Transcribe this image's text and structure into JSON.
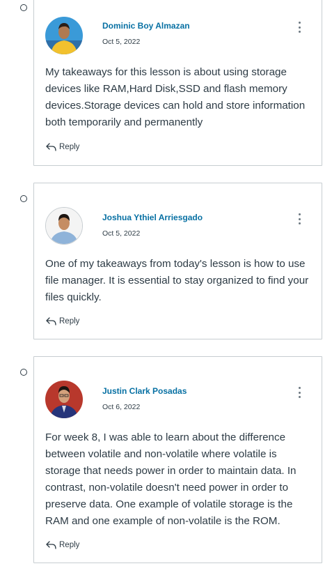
{
  "posts": [
    {
      "author": "Dominic Boy Almazan",
      "date": "Oct 5, 2022",
      "body": "My takeaways for this lesson is about using storage devices like RAM,Hard Disk,SSD and flash memory devices.Storage devices can hold and store information both temporarily and permanently",
      "reply_label": "Reply"
    },
    {
      "author": "Joshua Ythiel Arriesgado",
      "date": "Oct 5, 2022",
      "body": "One of my takeaways from today's lesson is how to use file manager. It is essential to stay organized to find your files quickly.",
      "reply_label": "Reply"
    },
    {
      "author": "Justin Clark Posadas",
      "date": "Oct 6, 2022",
      "body": "For week 8, I was able to learn about the difference between volatile and non-volatile where volatile is storage that needs power in order to maintain data. In contrast, non-volatile doesn't need power in order to preserve data. One example of volatile storage is the RAM and one example of non-volatile is the ROM.",
      "reply_label": "Reply"
    }
  ],
  "colors": {
    "author_link": "#0770a3",
    "text": "#2d3b45",
    "card_border": "#c7cdd1"
  },
  "icons": {
    "reply": "reply-arrow-icon",
    "options": "kebab-menu-icon",
    "thread_marker": "circle-bullet-icon"
  }
}
